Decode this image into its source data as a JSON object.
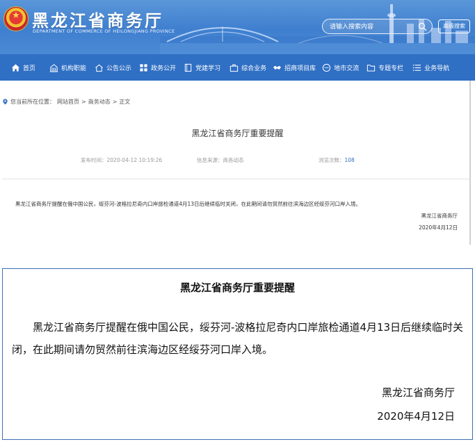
{
  "header": {
    "title": "黑龙江省商务厅",
    "subtitle": "DEPARTMENT OF COMMERCE OF HEILONGJIANG PROVINCE",
    "search_placeholder": "请输入搜索内容",
    "advanced_search": "高级搜索"
  },
  "nav": {
    "items": [
      {
        "label": "首页",
        "icon": "home-icon"
      },
      {
        "label": "机构职能",
        "icon": "building-icon"
      },
      {
        "label": "公告公示",
        "icon": "house-icon"
      },
      {
        "label": "政务公开",
        "icon": "grid-icon"
      },
      {
        "label": "党建学习",
        "icon": "book-icon"
      },
      {
        "label": "综合业务",
        "icon": "briefcase-icon"
      },
      {
        "label": "招商项目库",
        "icon": "handshake-icon"
      },
      {
        "label": "地市交流",
        "icon": "chat-icon"
      },
      {
        "label": "专题专栏",
        "icon": "folder-icon"
      },
      {
        "label": "业务导航",
        "icon": "list-icon"
      }
    ]
  },
  "breadcrumb": {
    "prefix": "您当前所在位置：",
    "items": [
      "网站首页",
      "商务动态",
      "正文"
    ],
    "separator": ">"
  },
  "article": {
    "title": "黑龙江省商务厅重要提醒",
    "published_label": "发布时间：",
    "published_value": "2020-04-12 10:19:26",
    "source_label": "信息来源：",
    "source_value": "商务动态",
    "views_label": "浏览次数：",
    "views_value": "108",
    "body": "黑龙江省商务厅提醒在俄中国公民，绥芬河-波格拉尼奇内口岸旅检通道4月13日后继续临时关闭，在此期间请勿贸然前往滨海边区经绥芬河口岸入境。",
    "signature": "黑龙江省商务厅",
    "date": "2020年4月12日"
  },
  "notice": {
    "title": "黑龙江省商务厅重要提醒",
    "body": "黑龙江省商务厅提醒在俄中国公民，绥芬河-波格拉尼奇内口岸旅检通道4月13日后继续临时关闭，在此期间请勿贸然前往滨海边区经绥芬河口岸入境。",
    "signature": "黑龙江省商务厅",
    "date": "2020年4月12日"
  },
  "colors": {
    "header_blue": "#4a8ad4",
    "nav_blue": "#2f6fc4",
    "notice_border": "#3b6fb6"
  }
}
